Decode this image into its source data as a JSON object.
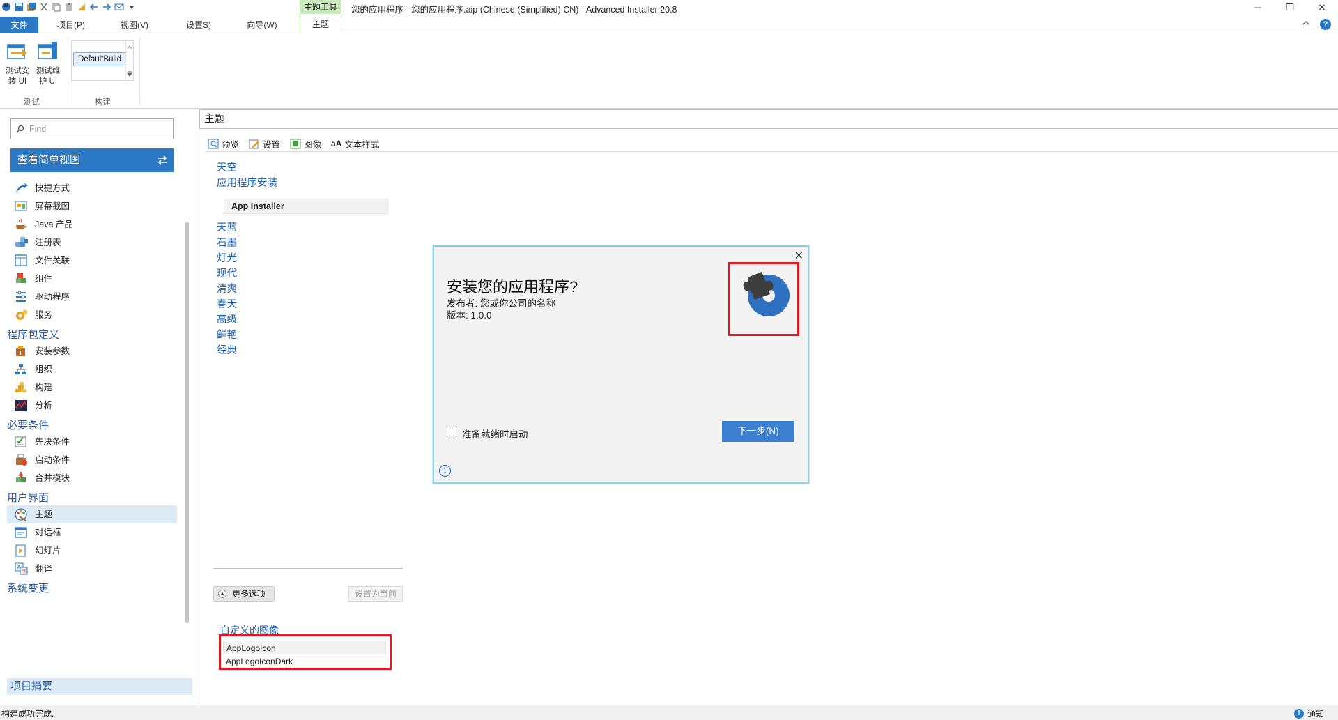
{
  "window": {
    "title": "您的应用程序 - 您的应用程序.aip (Chinese (Simplified) CN) - Advanced Installer 20.8",
    "context_tab_group": "主题工具",
    "minimize": "─",
    "restore": "❐",
    "close": "✕"
  },
  "ribbon_tabs": [
    "文件",
    "项目(P)",
    "视图(V)",
    "设置S)",
    "向导(W)",
    "主题"
  ],
  "ribbon": {
    "test_install_ui": "测试安装 UI",
    "test_maintenance_ui": "测试维护 UI",
    "build_config": "DefaultBuild",
    "group_test": "测试",
    "group_build": "构建"
  },
  "nav": {
    "find_placeholder": "Find",
    "simple_view": "查看简单视图",
    "items1": [
      "快捷方式",
      "屏幕截图",
      "Java 产品",
      "注册表",
      "文件关联",
      "组件",
      "驱动程序",
      "服务"
    ],
    "section_customize": "程序包定义",
    "items2": [
      "安装参数",
      "组织",
      "构建",
      "分析"
    ],
    "section_prereq": "必要条件",
    "items3": [
      "先决条件",
      "启动条件",
      "合并模块"
    ],
    "section_ui": "用户界面",
    "items4": [
      "主题",
      "对话框",
      "幻灯片",
      "翻译"
    ],
    "section_sys": "系统变更",
    "project_summary": "项目摘要"
  },
  "main": {
    "header": "主题",
    "subtabs": [
      "预览",
      "设置",
      "图像",
      "文本样式"
    ],
    "theme_list": [
      "天空",
      "应用程序安装",
      "天蓝",
      "石墨",
      "灯光",
      "现代",
      "清爽",
      "春天",
      "高级",
      "鲜艳",
      "经典"
    ],
    "selected_theme": "App Installer",
    "more_options": "更多选项",
    "set_current": "设置为当前",
    "custom_images_label": "自定义的图像",
    "custom_images": [
      "AppLogoIcon",
      "AppLogoIconDark"
    ]
  },
  "preview": {
    "title": "安装您的应用程序?",
    "publisher": "发布者: 您或你公司的名称",
    "version": "版本: 1.0.0",
    "launch_checkbox": "准备就绪时启动",
    "next_button": "下一步(N)",
    "close": "✕",
    "info": "i"
  },
  "status": {
    "text": "构建成功完成.",
    "notifications": "通知"
  },
  "colors": {
    "accent": "#2b78c5",
    "highlight_red": "#e01a22",
    "link_blue": "#1a5fb4",
    "context_green": "#8dc26f"
  }
}
